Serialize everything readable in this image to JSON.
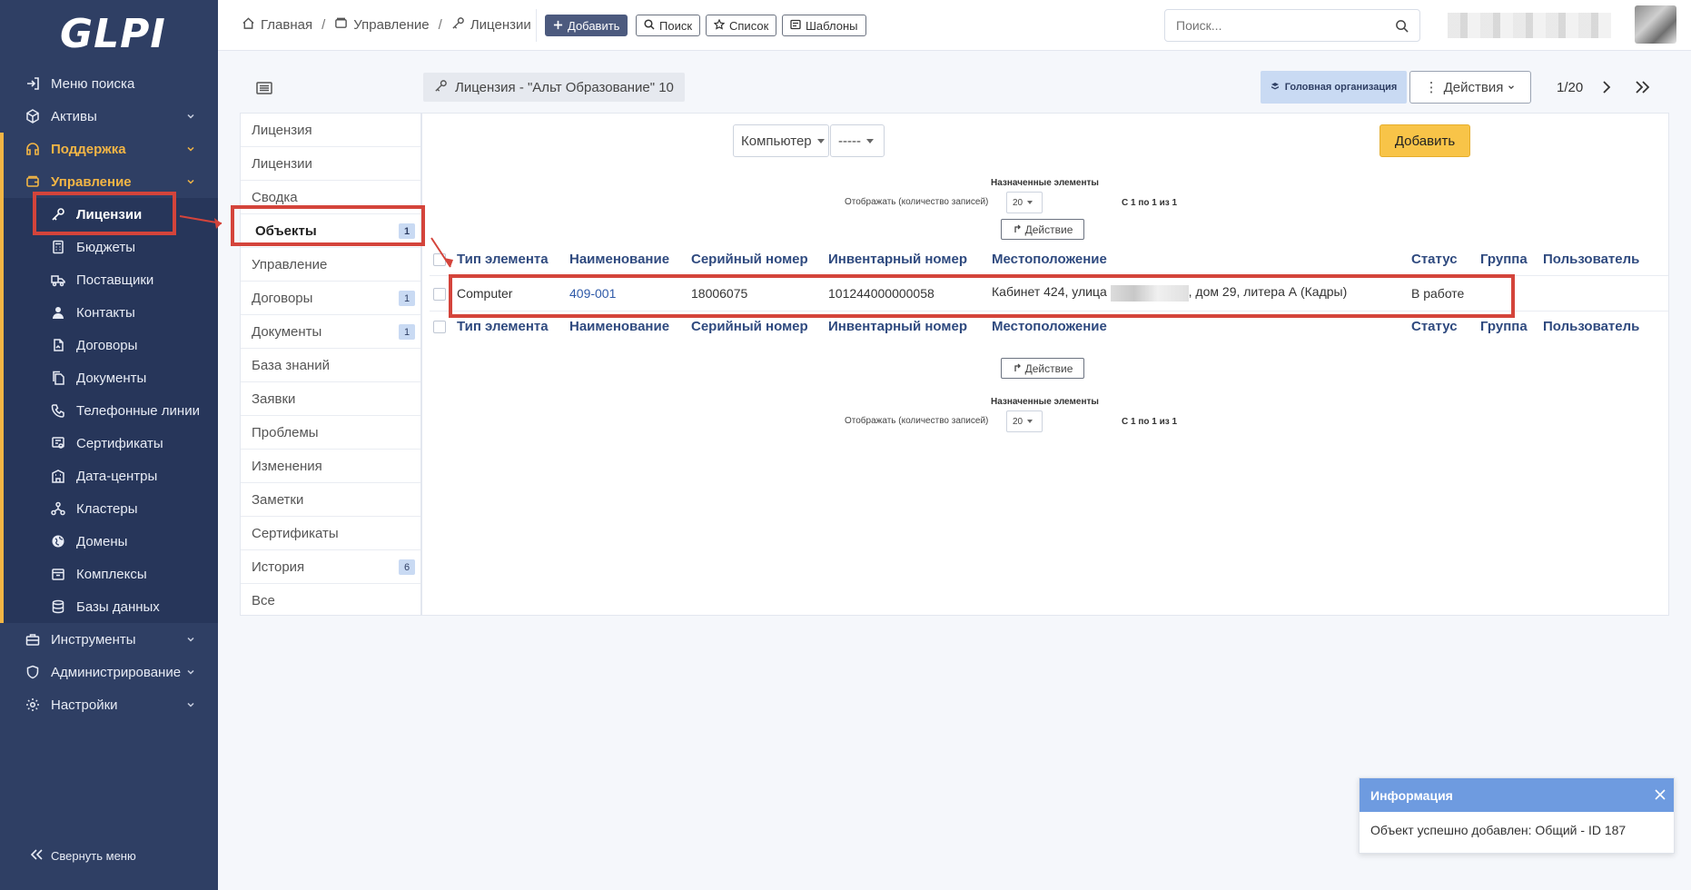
{
  "app": {
    "logo_text": "GLPI"
  },
  "sidebar": {
    "items": [
      {
        "label": "Меню поиска",
        "icon": "arrow-right-to-bracket-icon"
      },
      {
        "label": "Активы",
        "icon": "cube-icon"
      },
      {
        "label": "Поддержка",
        "icon": "headset-icon"
      },
      {
        "label": "Управление",
        "icon": "wallet-icon"
      }
    ],
    "sub_items": [
      {
        "label": "Лицензии",
        "icon": "key-icon"
      },
      {
        "label": "Бюджеты",
        "icon": "calculator-icon"
      },
      {
        "label": "Поставщики",
        "icon": "truck-icon"
      },
      {
        "label": "Контакты",
        "icon": "user-icon"
      },
      {
        "label": "Договоры",
        "icon": "contract-icon"
      },
      {
        "label": "Документы",
        "icon": "files-icon"
      },
      {
        "label": "Телефонные линии",
        "icon": "phone-icon"
      },
      {
        "label": "Сертификаты",
        "icon": "certificate-icon"
      },
      {
        "label": "Дата-центры",
        "icon": "building-icon"
      },
      {
        "label": "Кластеры",
        "icon": "hierarchy-icon"
      },
      {
        "label": "Домены",
        "icon": "globe-icon"
      },
      {
        "label": "Комплексы",
        "icon": "box-icon"
      },
      {
        "label": "Базы данных",
        "icon": "database-icon"
      }
    ],
    "bottom_items": [
      {
        "label": "Инструменты",
        "icon": "briefcase-icon"
      },
      {
        "label": "Администрирование",
        "icon": "shield-icon"
      },
      {
        "label": "Настройки",
        "icon": "gear-icon"
      }
    ],
    "collapse_label": "Свернуть меню"
  },
  "topbar": {
    "breadcrumbs": [
      "Главная",
      "Управление",
      "Лицензии"
    ],
    "buttons": {
      "add": "Добавить",
      "search": "Поиск",
      "list": "Список",
      "templates": "Шаблоны"
    },
    "search_placeholder": "Поиск..."
  },
  "item": {
    "title": "Лицензия - \"Альт Образование\" 10",
    "entity": "Головная организация",
    "actions_label": "Действия",
    "pager": "1/20"
  },
  "tabs": [
    {
      "label": "Лицензия",
      "count": ""
    },
    {
      "label": "Лицензии",
      "count": ""
    },
    {
      "label": "Сводка",
      "count": ""
    },
    {
      "label": "Объекты",
      "count": "1"
    },
    {
      "label": "Управление",
      "count": ""
    },
    {
      "label": "Договоры",
      "count": "1"
    },
    {
      "label": "Документы",
      "count": "1"
    },
    {
      "label": "База знаний",
      "count": ""
    },
    {
      "label": "Заявки",
      "count": ""
    },
    {
      "label": "Проблемы",
      "count": ""
    },
    {
      "label": "Изменения",
      "count": ""
    },
    {
      "label": "Заметки",
      "count": ""
    },
    {
      "label": "Сертификаты",
      "count": ""
    },
    {
      "label": "История",
      "count": "6"
    },
    {
      "label": "Все",
      "count": ""
    }
  ],
  "objects": {
    "type_select": "Компьютер",
    "item_select": "-----",
    "add_button": "Добавить",
    "pagination": {
      "title": "Назначенные элементы",
      "per_page_label": "Отображать (количество записей)",
      "per_page_value": "20",
      "count_text": "С 1 по 1 из 1"
    },
    "action_button": "Действие",
    "columns": [
      "Тип элемента",
      "Наименование",
      "Серийный номер",
      "Инвентарный номер",
      "Местоположение",
      "Статус",
      "Группа",
      "Пользователь"
    ],
    "rows": [
      {
        "type": "Computer",
        "name": "409-001",
        "serial": "18006075",
        "inventory": "101244000000058",
        "location_prefix": "Кабинет 424, улица",
        "location_suffix": ", дом 29, литера А (Кадры)",
        "status": "В работе",
        "group": "",
        "user": ""
      }
    ]
  },
  "toast": {
    "title": "Информация",
    "message": "Объект успешно добавлен: Общий - ID 187"
  },
  "colors": {
    "sidebar_bg": "#2f3f64",
    "accent": "#f2b545",
    "annotation": "#d4443b",
    "toast_header": "#6e9be0"
  }
}
